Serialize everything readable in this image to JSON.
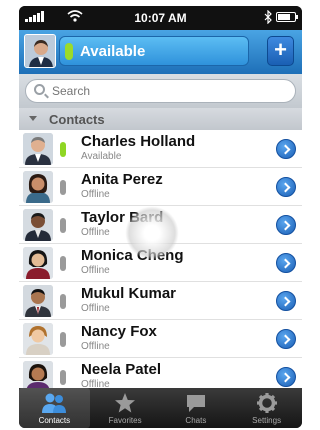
{
  "status_bar": {
    "time": "10:07 AM"
  },
  "header": {
    "presence": "Available",
    "add_label": "+"
  },
  "search": {
    "placeholder": "Search"
  },
  "section": {
    "title": "Contacts"
  },
  "contacts": [
    {
      "name": "Charles Holland",
      "status": "Available",
      "online": true
    },
    {
      "name": "Anita Perez",
      "status": "Offline",
      "online": false
    },
    {
      "name": "Taylor Bard",
      "status": "Offline",
      "online": false
    },
    {
      "name": "Monica Cheng",
      "status": "Offline",
      "online": false
    },
    {
      "name": "Mukul Kumar",
      "status": "Offline",
      "online": false
    },
    {
      "name": "Nancy Fox",
      "status": "Offline",
      "online": false
    },
    {
      "name": "Neela Patel",
      "status": "Offline",
      "online": false
    }
  ],
  "tabs": [
    {
      "label": "Contacts",
      "icon": "contacts-icon",
      "active": true
    },
    {
      "label": "Favorites",
      "icon": "star-icon",
      "active": false
    },
    {
      "label": "Chats",
      "icon": "chat-icon",
      "active": false
    },
    {
      "label": "Settings",
      "icon": "gear-icon",
      "active": false
    }
  ],
  "colors": {
    "accent": "#2f92db",
    "available": "#8fd624",
    "offline": "#9a9a9a"
  }
}
